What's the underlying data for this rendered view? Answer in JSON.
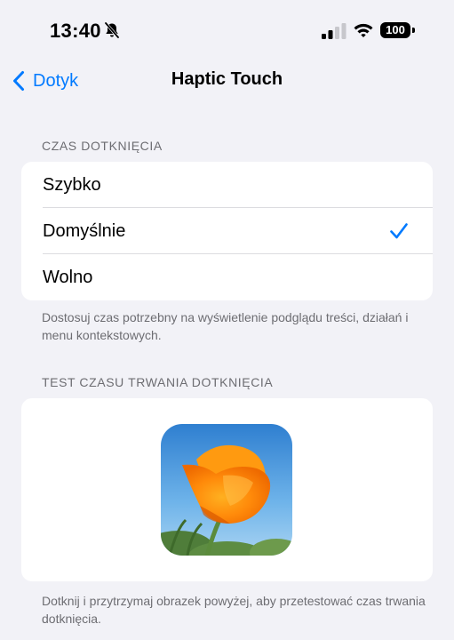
{
  "status_bar": {
    "time": "13:40",
    "battery": "100",
    "icons": [
      "bell-slash-icon",
      "signal-icon",
      "wifi-icon",
      "battery-icon"
    ]
  },
  "nav": {
    "back_label": "Dotyk",
    "title": "Haptic Touch"
  },
  "touch_duration": {
    "header": "CZAS DOTKNIĘCIA",
    "options": [
      {
        "label": "Szybko",
        "selected": false
      },
      {
        "label": "Domyślnie",
        "selected": true
      },
      {
        "label": "Wolno",
        "selected": false
      }
    ],
    "footer": "Dostosuj czas potrzebny na wyświetlenie podglądu treści, działań i menu kontekstowych."
  },
  "test": {
    "header": "TEST CZASU TRWANIA DOTKNIĘCIA",
    "image_icon": "poppy-flower-photo",
    "footer": "Dotknij i przytrzymaj obrazek powyżej, aby przetestować czas trwania dotknięcia."
  },
  "colors": {
    "accent": "#007aff",
    "background": "#f2f2f7",
    "card": "#ffffff",
    "secondary_text": "#6d6d72"
  }
}
